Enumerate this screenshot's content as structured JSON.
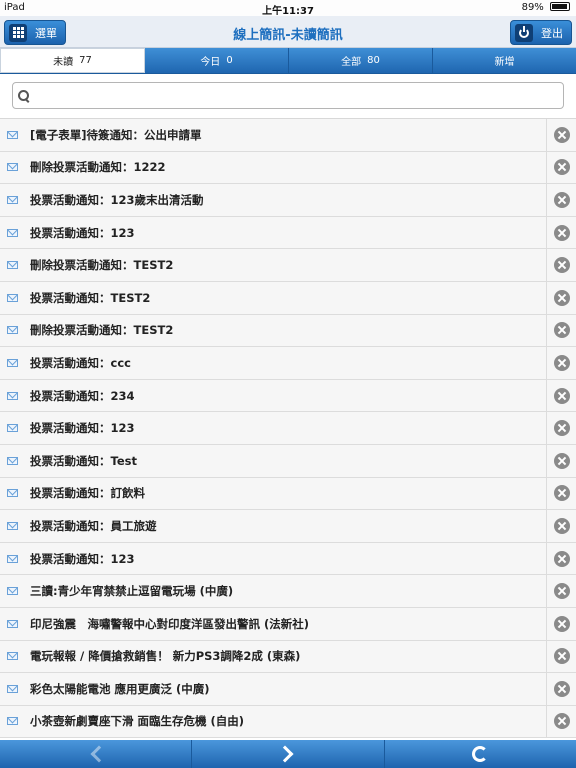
{
  "status": {
    "device": "iPad",
    "time": "上午11:37",
    "battery": "89%"
  },
  "header": {
    "title": "線上簡訊-未讀簡訊",
    "menu_label": "選單",
    "logout_label": "登出"
  },
  "tabs": [
    {
      "label": "未讀",
      "count": "77"
    },
    {
      "label": "今日",
      "count": "0"
    },
    {
      "label": "全部",
      "count": "80"
    },
    {
      "label": "新增",
      "count": ""
    }
  ],
  "search": {
    "placeholder": "",
    "value": ""
  },
  "messages": [
    "[電子表單]待簽通知：公出申請單",
    "刪除投票活動通知：1222",
    "投票活動通知：123歲末出清活動",
    "投票活動通知：123",
    "刪除投票活動通知：TEST2",
    "投票活動通知：TEST2",
    "刪除投票活動通知：TEST2",
    "投票活動通知：ccc",
    "投票活動通知：234",
    "投票活動通知：123",
    "投票活動通知：Test",
    "投票活動通知：訂飲料",
    "投票活動通知：員工旅遊",
    "投票活動通知：123",
    "三讀:青少年宵禁禁止逗留電玩場 (中廣)",
    "印尼強震　海嘯警報中心對印度洋區發出警訊 (法新社)",
    "電玩報報 / 降價搶救銷售！ 新力PS3調降2成 (東森)",
    "彩色太陽能電池 應用更廣泛 (中廣)",
    "小茶壺新劇賣座下滑 面臨生存危機 (自由)"
  ],
  "icons": {
    "menu": "grid-icon",
    "logout": "power-icon",
    "search": "search-icon",
    "mail": "envelope-icon",
    "delete": "close-circle-icon",
    "prev": "chevron-left-icon",
    "next": "chevron-right-icon",
    "refresh": "refresh-icon"
  }
}
